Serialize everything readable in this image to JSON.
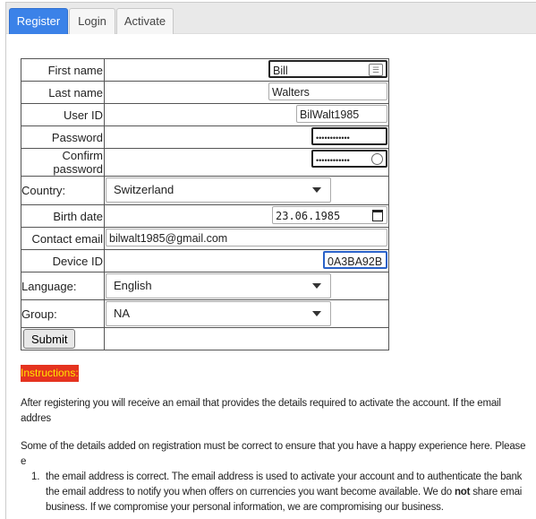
{
  "tabs": [
    {
      "label": "Register",
      "active": true
    },
    {
      "label": "Login"
    },
    {
      "label": "Activate"
    }
  ],
  "form": {
    "first_name": {
      "label": "First name",
      "value": "Bill",
      "icon": "contact-card-icon"
    },
    "last_name": {
      "label": "Last name",
      "value": "Walters"
    },
    "user_id": {
      "label": "User ID",
      "value": "BilWalt1985"
    },
    "password": {
      "label": "Password",
      "value": "••••••••••••"
    },
    "confirm_password": {
      "label": "Confirm password",
      "value": "••••••••••••",
      "icon": "password-key-icon"
    },
    "country": {
      "label": "Country:",
      "value": "Switzerland"
    },
    "birth_date": {
      "label": "Birth date",
      "value": "23.06.1985",
      "icon": "calendar-icon"
    },
    "contact_email": {
      "label": "Contact email",
      "value": "bilwalt1985@gmail.com"
    },
    "device_id": {
      "label": "Device ID",
      "value": "0A3BA92B"
    },
    "language": {
      "label": "Language:",
      "value": "English"
    },
    "group": {
      "label": "Group:",
      "value": "NA"
    },
    "submit": "Submit"
  },
  "instructions": {
    "heading": "Instructions:",
    "p1": "After registering you will receive an email that provides the details required to activate the account. If the email addres",
    "p2": "Some of the details added on registration must be correct to ensure that you have a happy experience here. Please e",
    "item1_num": "1.",
    "item1_a": "the email address is correct. The email address is used to activate your account and to authenticate the bank",
    "item1_b1": "the email address to notify you when offers on currencies you want become available. We do ",
    "item1_b_bold": "not",
    "item1_b2": " share emai",
    "item1_c": "business. If we compromise your personal information, we are compromising our business."
  }
}
